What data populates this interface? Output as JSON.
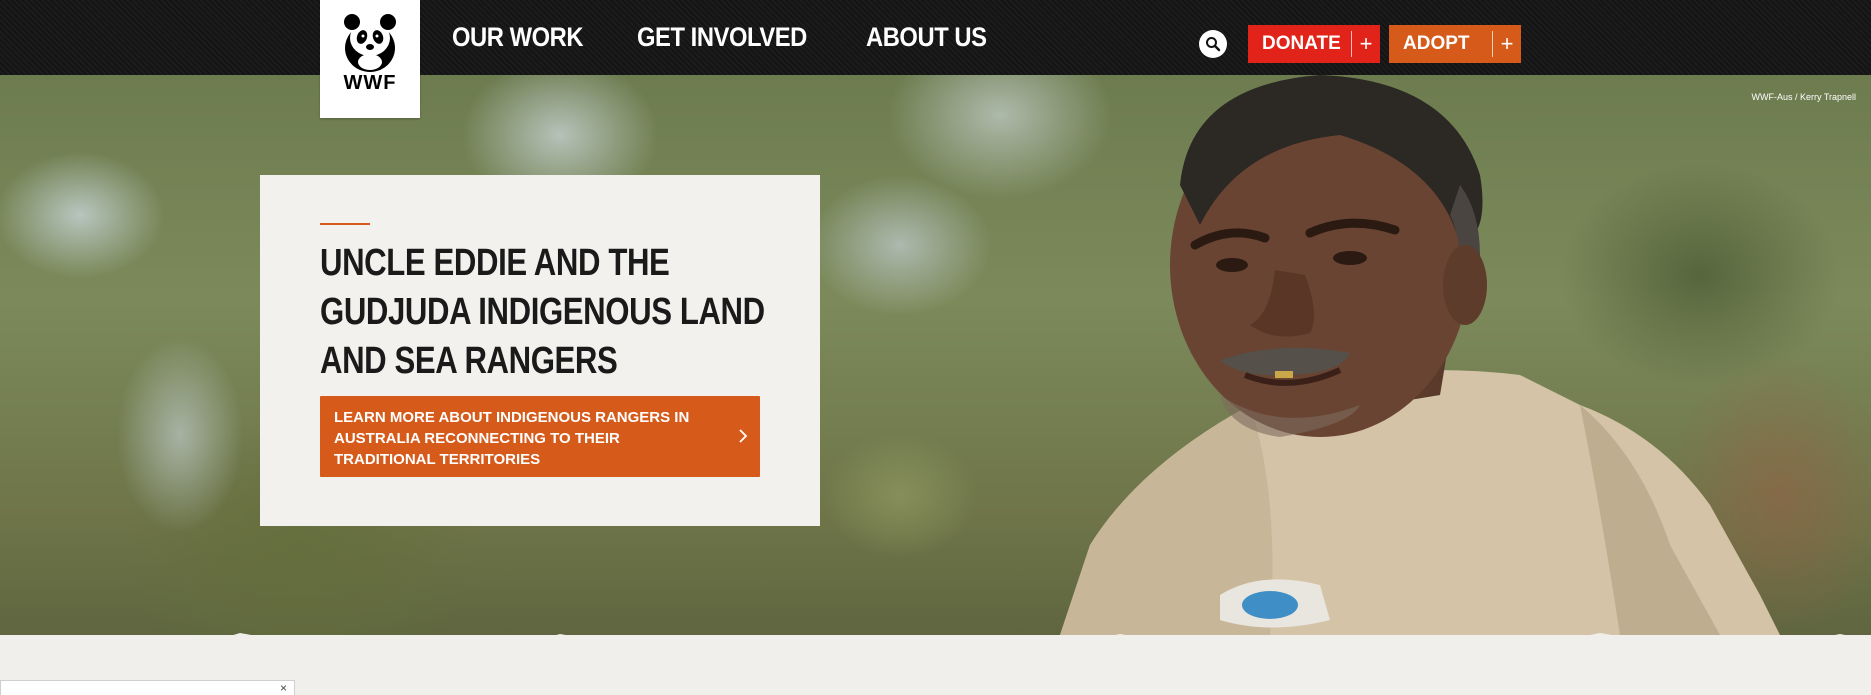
{
  "brand": {
    "logo_text": "WWF",
    "accent": "#d65a1a",
    "donate_color": "#e2231a"
  },
  "nav": {
    "items": [
      {
        "label": "OUR WORK"
      },
      {
        "label": "GET INVOLVED"
      },
      {
        "label": "ABOUT US"
      }
    ]
  },
  "header": {
    "search_icon": "search-icon",
    "donate_label": "DONATE",
    "adopt_label": "ADOPT",
    "plus_symbol": "+"
  },
  "hero": {
    "photo_credit": "WWF-Aus / Kerry Trapnell",
    "title": "UNCLE EDDIE AND THE GUDJUDA INDIGENOUS LAND AND SEA RANGERS",
    "cta_label": "LEARN MORE ABOUT INDIGENOUS RANGERS IN AUSTRALIA RECONNECTING TO THEIR TRADITIONAL TERRITORIES",
    "cta_icon": "chevron-right-icon"
  },
  "bottom": {
    "close_symbol": "×"
  }
}
